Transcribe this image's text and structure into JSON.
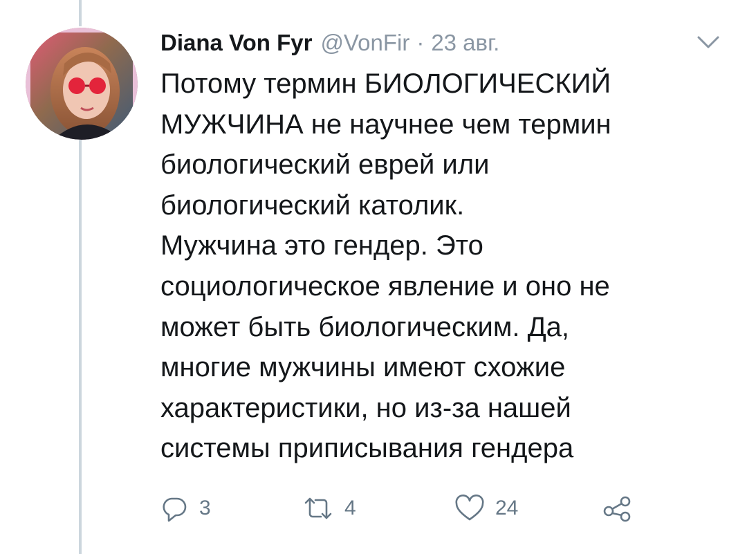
{
  "tweet": {
    "author_name": "Diana Von Fyr",
    "handle": "@VonFir",
    "separator": "·",
    "date": "23 авг.",
    "text_lines": [
      "Потому термин БИОЛОГИЧЕСКИЙ",
      "МУЖЧИНА не научнее чем термин",
      "биологический еврей или",
      "биологический католик.",
      "Мужчина это гендер. Это",
      "социологическое явление и оно не",
      "может быть биологическим. Да,",
      "многие мужчины имеют схожие",
      "характеристики, но из-за нашей",
      "системы приписывания гендера"
    ],
    "actions": {
      "reply_count": "3",
      "retweet_count": "4",
      "like_count": "24"
    }
  },
  "icons": {
    "reply": "reply-icon",
    "retweet": "retweet-icon",
    "like": "heart-icon",
    "share": "share-icon",
    "caret": "chevron-down-icon"
  },
  "colors": {
    "text": "#14171a",
    "secondary": "#8a96a3",
    "icon": "#657786",
    "thread_line": "#ccd6dd"
  }
}
